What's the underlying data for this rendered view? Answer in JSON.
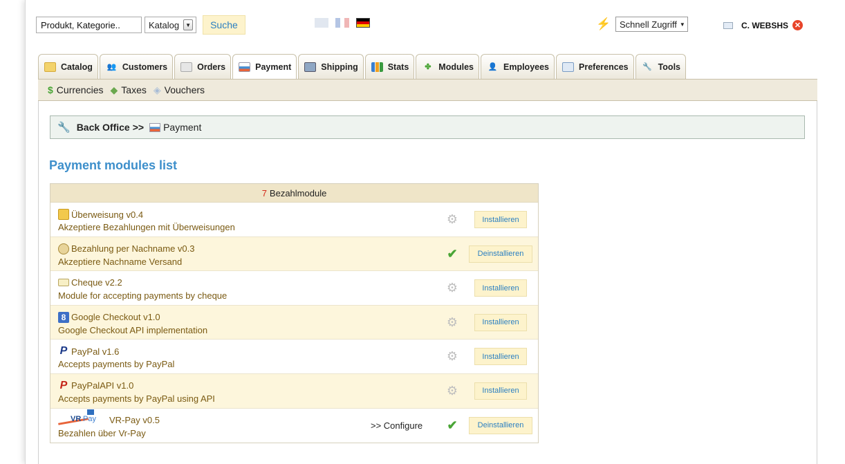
{
  "header": {
    "search_value": "Produkt, Kategorie..",
    "search_scope": "Katalog",
    "search_button": "Suche",
    "languages": [
      "en",
      "fr",
      "de"
    ],
    "quick_access": "Schnell Zugriff",
    "username": "C. WEBSHS"
  },
  "tabs": [
    {
      "label": "Catalog",
      "icon": "folder-icon",
      "active": false
    },
    {
      "label": "Customers",
      "icon": "customers-icon",
      "active": false
    },
    {
      "label": "Orders",
      "icon": "orders-icon",
      "active": false
    },
    {
      "label": "Payment",
      "icon": "payment-icon",
      "active": true
    },
    {
      "label": "Shipping",
      "icon": "truck-icon",
      "active": false
    },
    {
      "label": "Stats",
      "icon": "stats-icon",
      "active": false
    },
    {
      "label": "Modules",
      "icon": "puzzle-icon",
      "active": false
    },
    {
      "label": "Employees",
      "icon": "employees-icon",
      "active": false
    },
    {
      "label": "Preferences",
      "icon": "preferences-icon",
      "active": false
    },
    {
      "label": "Tools",
      "icon": "wrench-icon",
      "active": false
    }
  ],
  "subtabs": [
    {
      "label": "Currencies",
      "icon": "dollar-icon"
    },
    {
      "label": "Taxes",
      "icon": "tax-icon"
    },
    {
      "label": "Vouchers",
      "icon": "voucher-icon"
    }
  ],
  "breadcrumb": {
    "root": "Back Office",
    "separator": ">>",
    "current": "Payment"
  },
  "page_title": "Payment modules list",
  "modules_header": {
    "count": "7",
    "label": "Bezahlmodule"
  },
  "modules": [
    {
      "name": "Überweisung v0.4",
      "description": "Akzeptiere Bezahlungen mit Überweisungen",
      "installed": false,
      "action": "Installieren"
    },
    {
      "name": "Bezahlung per Nachname v0.3",
      "description": "Akzeptiere Nachname Versand",
      "installed": true,
      "action": "Deinstallieren"
    },
    {
      "name": "Cheque v2.2",
      "description": "Module for accepting payments by cheque",
      "installed": false,
      "action": "Installieren"
    },
    {
      "name": "Google Checkout v1.0",
      "description": "Google Checkout API implementation",
      "installed": false,
      "action": "Installieren"
    },
    {
      "name": "PayPal v1.6",
      "description": "Accepts payments by PayPal",
      "installed": false,
      "action": "Installieren"
    },
    {
      "name": "PayPalAPI v1.0",
      "description": "Accepts payments by PayPal using API",
      "installed": false,
      "action": "Installieren"
    },
    {
      "name": "VR-Pay v0.5",
      "description": "Bezahlen über Vr-Pay",
      "installed": true,
      "action": "Deinstallieren",
      "configure": ">> Configure"
    }
  ]
}
